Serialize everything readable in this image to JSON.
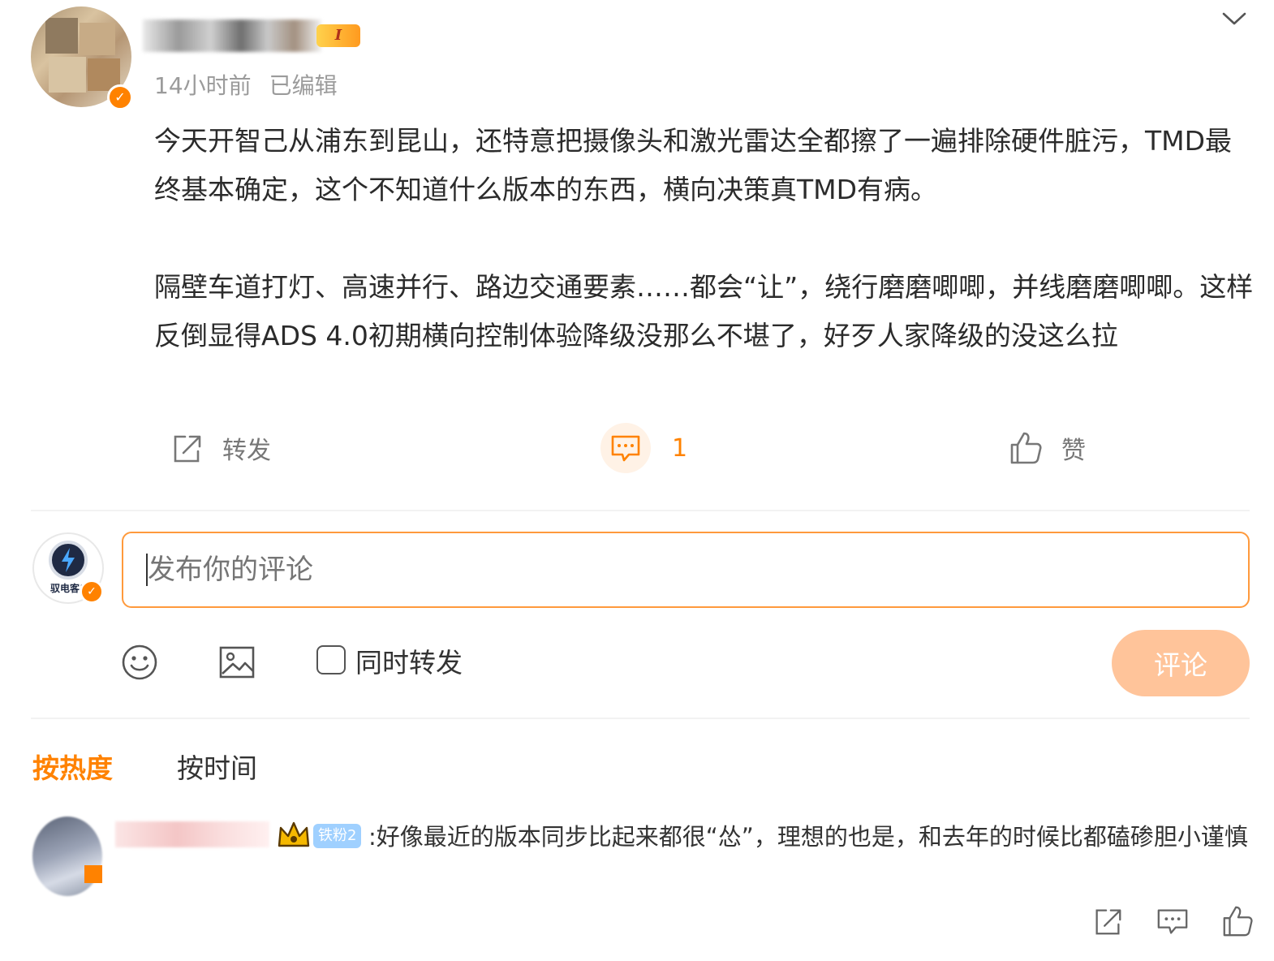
{
  "post": {
    "author_level": "I",
    "time": "14小时前",
    "edited": "已编辑",
    "paragraphs": [
      "今天开智己从浦东到昆山，还特意把摄像头和激光雷达全都擦了一遍排除硬件脏污，TMD最终基本确定，这个不知道什么版本的东西，横向决策真TMD有病。",
      "",
      "隔壁车道打灯、高速并行、路边交通要素……都会“让”，绕行磨磨唧唧，并线磨磨唧唧。这样反倒显得ADS 4.0初期横向控制体验降级没那么不堪了，好歹人家降级的没这么拉"
    ],
    "actions": {
      "repost_label": "转发",
      "comment_count": "1",
      "like_label": "赞"
    }
  },
  "composer": {
    "avatar_text": "驭电客户",
    "placeholder": "发布你的评论",
    "repost_label": "同时转发",
    "submit_label": "评论"
  },
  "sort": {
    "hot": "按热度",
    "time": "按时间"
  },
  "comment": {
    "fan_badge": "铁粉2",
    "text": ":好像最近的版本同步比起来都很“怂”，理想的也是，和去年的时候比都磕碜胆小谨慎"
  },
  "colors": {
    "accent": "#ff8200",
    "input_border": "#ff9a3c",
    "submit_bg": "#ffc49a",
    "meta_text": "#9b9b9b"
  },
  "icons": [
    "chevron-down-icon",
    "repost-icon",
    "comment-icon",
    "like-icon",
    "emoji-icon",
    "image-icon",
    "crown-icon"
  ]
}
